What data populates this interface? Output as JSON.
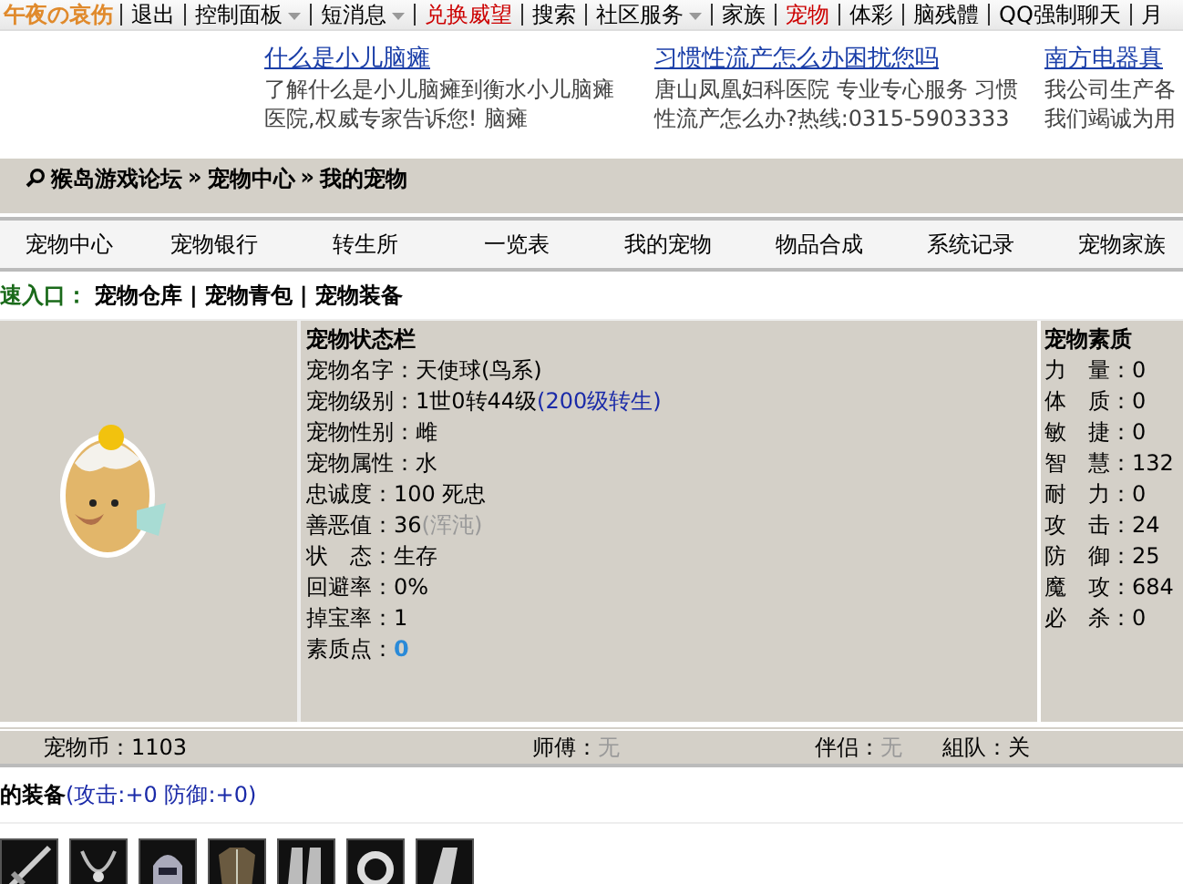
{
  "top_nav": {
    "user": "午夜の哀伤",
    "items": [
      {
        "label": "退出",
        "highlight": false,
        "dropdown": false
      },
      {
        "label": "控制面板",
        "highlight": false,
        "dropdown": true
      },
      {
        "label": "短消息",
        "highlight": false,
        "dropdown": true
      },
      {
        "label": "兑换威望",
        "highlight": true,
        "dropdown": false
      },
      {
        "label": "搜索",
        "highlight": false,
        "dropdown": false
      },
      {
        "label": "社区服务",
        "highlight": false,
        "dropdown": true
      },
      {
        "label": "家族",
        "highlight": false,
        "dropdown": false
      },
      {
        "label": "宠物",
        "highlight": true,
        "dropdown": false
      },
      {
        "label": "体彩",
        "highlight": false,
        "dropdown": false
      },
      {
        "label": "脑残體",
        "highlight": false,
        "dropdown": false
      },
      {
        "label": "QQ强制聊天",
        "highlight": false,
        "dropdown": false
      },
      {
        "label": "月",
        "highlight": false,
        "dropdown": false
      }
    ]
  },
  "ads": [
    {
      "title": "什么是小儿脑瘫",
      "text": "了解什么是小儿脑瘫到衡水小儿脑瘫医院,权威专家告诉您! 脑瘫"
    },
    {
      "title": "习惯性流产怎么办困扰您吗",
      "text": "唐山凤凰妇科医院 专业专心服务 习惯性流产怎么办?热线:0315-5903333"
    },
    {
      "title": "南方电器真",
      "text": "我公司生产各我们竭诚为用"
    }
  ],
  "breadcrumb": {
    "separator": "»",
    "items": [
      "猴岛游戏论坛",
      "宠物中心",
      "我的宠物"
    ]
  },
  "tabs": [
    "宠物中心",
    "宠物银行",
    "转生所",
    "一览表",
    "我的宠物",
    "物品合成",
    "系统记录",
    "宠物家族"
  ],
  "quick_entry": {
    "label": "速入口：",
    "separator": "|",
    "links": [
      "宠物仓库",
      "宠物青包",
      "宠物装备"
    ]
  },
  "status": {
    "title": "宠物状态栏",
    "rows": [
      {
        "label": "宠物名字：",
        "value": "天使球(鸟系)"
      },
      {
        "label": "宠物级别：",
        "value": "1世0转44级",
        "note": {
          "text": "(200级转生)",
          "kind": "link"
        }
      },
      {
        "label": "宠物性别：",
        "value": "雌"
      },
      {
        "label": "宠物属性：",
        "value": "水"
      },
      {
        "label": "忠诚度：",
        "value": "100 死忠"
      },
      {
        "label": "善恶值：",
        "value": "36",
        "note": {
          "text": "(浑沌)",
          "kind": "muted"
        }
      },
      {
        "label": "状　态：",
        "value": "生存"
      },
      {
        "label": "回避率：",
        "value": "0%"
      },
      {
        "label": "掉宝率：",
        "value": "1"
      },
      {
        "label": "素质点：",
        "value": "0",
        "highlight": true
      }
    ]
  },
  "attributes": {
    "title": "宠物素质",
    "rows": [
      {
        "label": "力　量：",
        "value": "0"
      },
      {
        "label": "体　质：",
        "value": "0"
      },
      {
        "label": "敏　捷：",
        "value": "0"
      },
      {
        "label": "智　慧：",
        "value": "132"
      },
      {
        "label": "耐　力：",
        "value": "0"
      },
      {
        "label": "攻　击：",
        "value": "24"
      },
      {
        "label": "防　御：",
        "value": "25"
      },
      {
        "label": "魔　攻：",
        "value": "684"
      },
      {
        "label": "必　杀：",
        "value": "0"
      }
    ]
  },
  "info_bar": [
    {
      "label": "宠物币：",
      "value": "1103",
      "muted": false
    },
    {
      "label": "师傅：",
      "value": "无",
      "muted": true
    },
    {
      "label": "伴侣：",
      "value": "无",
      "muted": true
    },
    {
      "label": "組队：",
      "value": "关",
      "muted": false
    }
  ],
  "equipment": {
    "title": "的装备",
    "bonus": "(攻击:+0 防御:+0)",
    "items": [
      {
        "kind": "sword"
      },
      {
        "kind": "necklace"
      },
      {
        "kind": "helmet"
      },
      {
        "kind": "armor"
      },
      {
        "kind": "boots"
      },
      {
        "kind": "ring"
      },
      {
        "kind": "bracer"
      }
    ]
  }
}
